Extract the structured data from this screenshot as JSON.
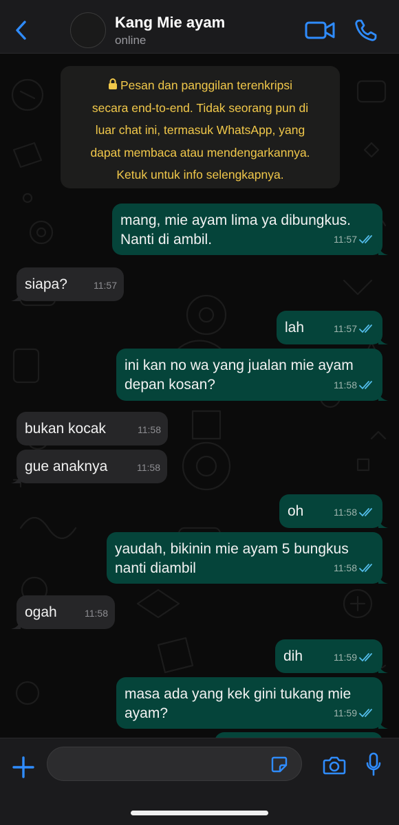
{
  "header": {
    "contact_name": "Kang Mie ayam",
    "status": "online"
  },
  "encryption_notice": {
    "lines": [
      "Pesan dan panggilan terenkripsi",
      "secara end-to-end. Tidak seorang pun di",
      "luar chat ini, termasuk WhatsApp, yang",
      "dapat membaca atau mendengarkannya.",
      "Ketuk untuk info selengkapnya."
    ]
  },
  "messages": [
    {
      "direction": "out",
      "lines": [
        "mang, mie ayam lima ya dibungkus.",
        "Nanti di ambil."
      ],
      "time": "11:57",
      "status": "read"
    },
    {
      "direction": "in",
      "lines": [
        "siapa?"
      ],
      "time": "11:57"
    },
    {
      "direction": "out",
      "lines": [
        "lah"
      ],
      "time": "11:57",
      "status": "read"
    },
    {
      "direction": "out",
      "lines": [
        "ini kan no wa yang jualan mie ayam",
        "depan kosan?"
      ],
      "time": "11:58",
      "status": "read"
    },
    {
      "direction": "in",
      "lines": [
        "bukan kocak"
      ],
      "time": "11:58"
    },
    {
      "direction": "in",
      "lines": [
        "gue anaknya"
      ],
      "time": "11:58"
    },
    {
      "direction": "out",
      "lines": [
        "oh"
      ],
      "time": "11:58",
      "status": "read"
    },
    {
      "direction": "out",
      "lines": [
        "yaudah, bikinin mie ayam 5 bungkus",
        "nanti diambil"
      ],
      "time": "11:58",
      "status": "read"
    },
    {
      "direction": "in",
      "lines": [
        "ogah"
      ],
      "time": "11:58"
    },
    {
      "direction": "out",
      "lines": [
        "dih"
      ],
      "time": "11:59",
      "status": "read"
    },
    {
      "direction": "out",
      "lines": [
        "masa ada yang kek gini tukang mie",
        "ayam?"
      ],
      "time": "11:59",
      "status": "read"
    }
  ],
  "composer": {
    "value": "",
    "placeholder": ""
  },
  "icons": {
    "back": "chevron-left-icon",
    "video": "video-camera-icon",
    "call": "phone-icon",
    "lock": "lock-icon",
    "plus": "plus-icon",
    "sticker": "sticker-icon",
    "camera": "camera-icon",
    "mic": "microphone-icon"
  },
  "colors": {
    "accent": "#2f8cff",
    "outgoing_bubble": "#05443a",
    "incoming_bubble": "#262628",
    "notice_text": "#f1c84a",
    "read_ticks": "#53bdeb"
  }
}
